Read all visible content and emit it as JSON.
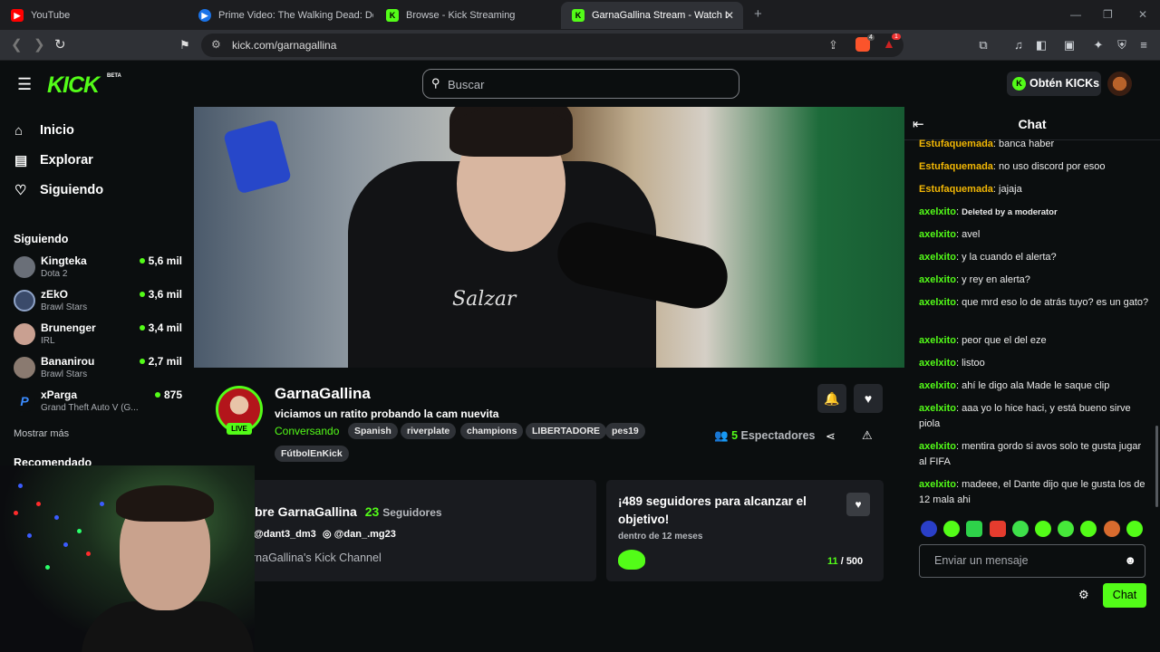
{
  "browser": {
    "tabs": [
      {
        "title": "YouTube",
        "icon": "youtube-icon"
      },
      {
        "title": "Prime Video: The Walking Dead: Dea",
        "icon": "prime-video-icon"
      },
      {
        "title": "Browse - Kick Streaming",
        "icon": "kick-icon"
      },
      {
        "title": "GarnaGallina Stream - Watch Liv",
        "icon": "kick-icon",
        "active": true
      }
    ],
    "url": "kick.com/garnagallina",
    "badges": {
      "brave": "4",
      "alert": "1"
    }
  },
  "header": {
    "logo": "KICK",
    "logo_sup": "BETA",
    "search_placeholder": "Buscar",
    "get_kicks": "Obtén KICKs"
  },
  "sidebar": {
    "nav": [
      {
        "label": "Inicio",
        "icon": "home-icon"
      },
      {
        "label": "Explorar",
        "icon": "explore-icon"
      },
      {
        "label": "Siguiendo",
        "icon": "heart-icon"
      }
    ],
    "following_heading": "Siguiendo",
    "following": [
      {
        "name": "Kingteka",
        "game": "Dota 2",
        "viewers": "5,6 mil"
      },
      {
        "name": "zEkO",
        "game": "Brawl Stars",
        "viewers": "3,6 mil"
      },
      {
        "name": "Brunenger",
        "game": "IRL",
        "viewers": "3,4 mil"
      },
      {
        "name": "Bananirou",
        "game": "Brawl Stars",
        "viewers": "2,7 mil"
      },
      {
        "name": "xParga",
        "game": "Grand Theft Auto V (G...",
        "viewers": "875"
      }
    ],
    "show_more": "Mostrar más",
    "recommended_heading": "Recomendado"
  },
  "stream": {
    "channel": "GarnaGallina",
    "live_badge": "LIVE",
    "title": "viciamos un ratito probando la cam nuevita",
    "category": "Conversando",
    "tags": [
      "Spanish",
      "riverplate",
      "champions",
      "LIBERTADORE",
      "pes19",
      "FútbolEnKick"
    ],
    "viewer_count": "5",
    "viewer_label": "Espectadores"
  },
  "about": {
    "title_prefix": "bre GarnaGallina",
    "followers_count": "23",
    "followers_label": "Seguidores",
    "social1": "@dant3_dm3",
    "social2": "@dan_.mg23",
    "description": "rnaGallina's Kick Channel"
  },
  "goal": {
    "title": "¡489 seguidores para alcanzar el objetivo!",
    "subtitle": "dentro de 12 meses",
    "current": "11",
    "target": "/ 500"
  },
  "chat": {
    "title": "Chat",
    "messages": [
      {
        "user": "Estufaquemada",
        "text": "banca haber",
        "color": "orange"
      },
      {
        "user": "Estufaquemada",
        "text": "no uso discord por esoo",
        "color": "orange"
      },
      {
        "user": "Estufaquemada",
        "text": "jajaja",
        "color": "orange"
      },
      {
        "user": "axelxito",
        "text": "Deleted by a moderator",
        "color": "green",
        "deleted": true
      },
      {
        "user": "axelxito",
        "text": "avel",
        "color": "green"
      },
      {
        "user": "axelxito",
        "text": "y la cuando el alerta?",
        "color": "green"
      },
      {
        "user": "axelxito",
        "text": "y rey en alerta?",
        "color": "green"
      },
      {
        "user": "axelxito",
        "text": "que mrd eso lo de atrás tuyo? es un gato?",
        "color": "green"
      },
      {
        "user": "axelxito",
        "text": "peor que el del eze",
        "color": "green"
      },
      {
        "user": "axelxito",
        "text": "listoo",
        "color": "green"
      },
      {
        "user": "axelxito",
        "text": "ahí le digo ala Made le saque clip",
        "color": "green"
      },
      {
        "user": "axelxito",
        "text": "aaa yo lo hice haci, y está bueno sirve piola",
        "color": "green"
      },
      {
        "user": "axelxito",
        "text": "mentira gordo si avos solo te gusta jugar al FIFA",
        "color": "green"
      },
      {
        "user": "axelxito",
        "text": "madeee, el Dante dijo que le gusta los de 12 mala ahi",
        "color": "green"
      }
    ],
    "input_placeholder": "Enviar un mensaje",
    "send_label": "Chat"
  },
  "colors": {
    "accent": "#53fc18",
    "bg": "#0b0e0f",
    "panel": "#191b1f",
    "username_orange": "#f2b705"
  }
}
